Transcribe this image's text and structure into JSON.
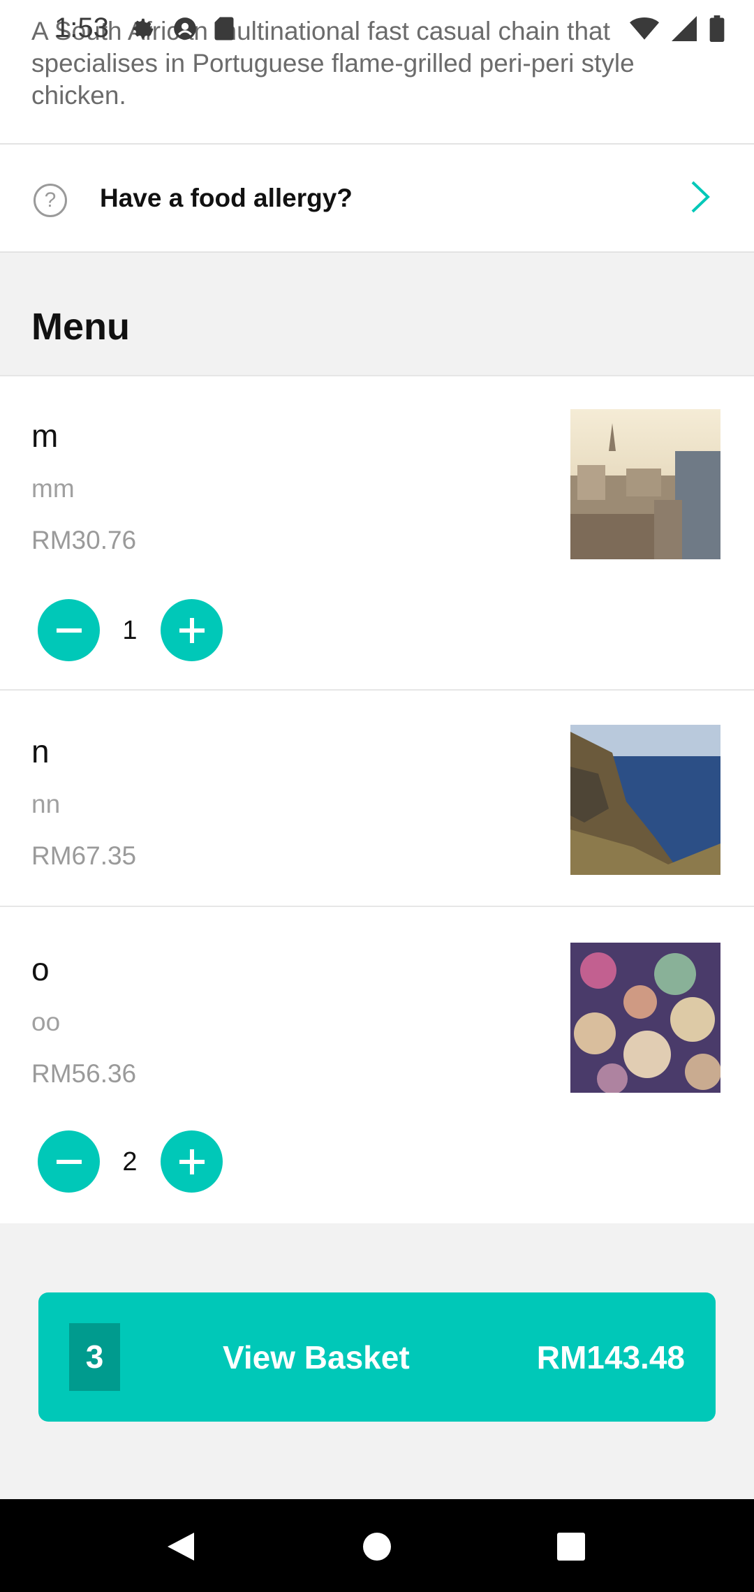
{
  "status_bar": {
    "time": "1:53"
  },
  "restaurant": {
    "description": "A South African multinational fast casual chain that specialises in Portuguese flame-grilled peri-peri style chicken."
  },
  "allergy": {
    "label": "Have a food allergy?",
    "icon": "help-circle-icon"
  },
  "menu": {
    "title": "Menu",
    "items": [
      {
        "name": "m",
        "description": "mm",
        "price": "RM30.76",
        "quantity": "1",
        "image": "city-skyline-photo"
      },
      {
        "name": "n",
        "description": "nn",
        "price": "RM67.35",
        "quantity": "",
        "image": "sea-cliff-photo"
      },
      {
        "name": "o",
        "description": "oo",
        "price": "RM56.36",
        "quantity": "2",
        "image": "bokeh-lights-photo"
      }
    ]
  },
  "basket": {
    "count": "3",
    "label": "View Basket",
    "total": "RM143.48"
  },
  "colors": {
    "accent": "#00c8b8",
    "accent_dark": "#009b8e",
    "background": "#f2f2f2"
  }
}
